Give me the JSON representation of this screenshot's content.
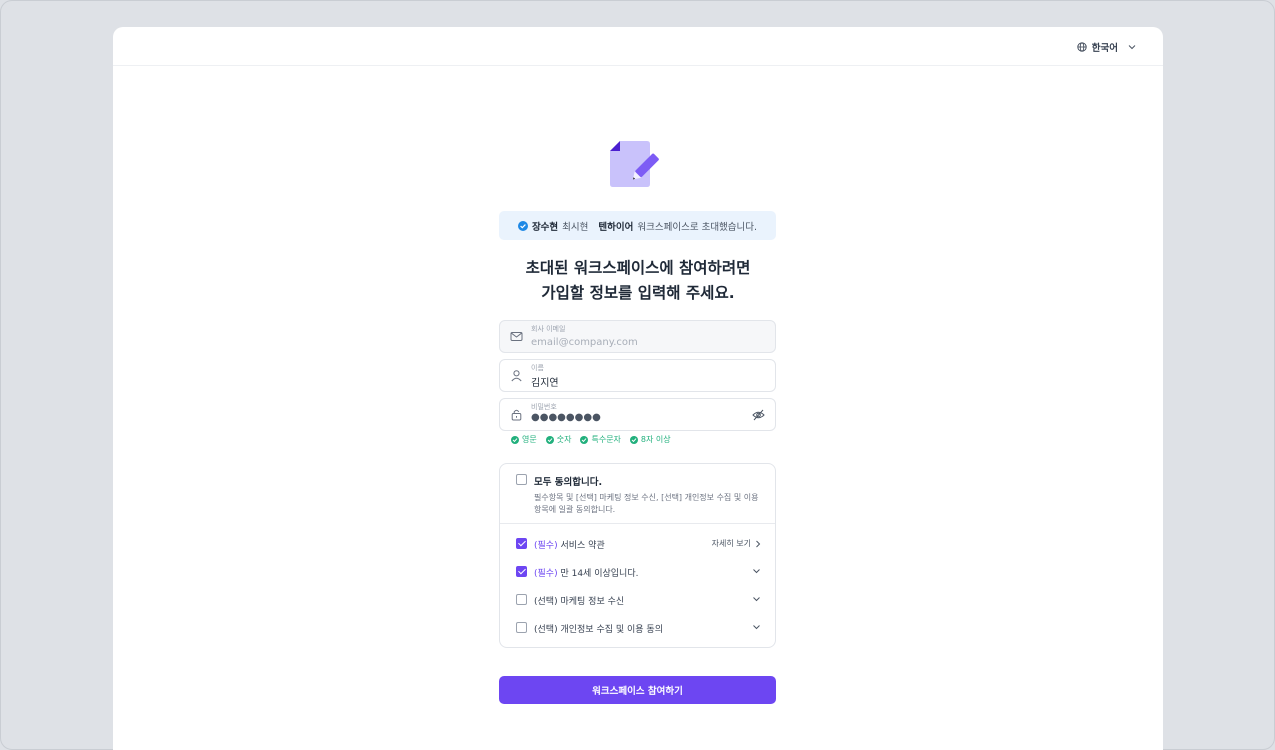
{
  "header": {
    "language_label": "한국어"
  },
  "banner": {
    "inviter": "장수현",
    "invitee": "최시현",
    "workspace": "텐하이어",
    "suffix": "워크스페이스로 초대했습니다."
  },
  "heading": {
    "line1": "초대된 워크스페이스에 참여하려면",
    "line2": "가입할 정보를 입력해 주세요."
  },
  "form": {
    "email": {
      "label": "회사 이메일",
      "placeholder": "email@company.com",
      "value": ""
    },
    "name": {
      "label": "이름",
      "value": "김지연"
    },
    "password": {
      "label": "비밀번호",
      "masked": "●●●●●●●●"
    }
  },
  "password_rules": [
    "영문",
    "숫자",
    "특수문자",
    "8자 이상"
  ],
  "terms": {
    "agree_all": {
      "title": "모두 동의합니다.",
      "description": "필수항목 및 [선택] 마케팅 정보 수신, [선택] 개인정보 수집 및 이용 항목에 일괄 동의합니다.",
      "checked": false
    },
    "items": [
      {
        "prefix": "(필수)",
        "label": "서비스 약관",
        "checked": true,
        "action": "자세히 보기"
      },
      {
        "prefix": "(필수)",
        "label": "만 14세 이상입니다.",
        "checked": true
      },
      {
        "prefix": "(선택)",
        "label": "마케팅 정보 수신",
        "checked": false
      },
      {
        "prefix": "(선택)",
        "label": "개인정보 수집 및 이용 동의",
        "checked": false
      }
    ]
  },
  "submit_label": "워크스페이스 참여하기",
  "colors": {
    "accent": "#6d46f2",
    "success": "#22b07d",
    "info": "#1e88e5",
    "banner_bg": "#eaf3fd"
  }
}
